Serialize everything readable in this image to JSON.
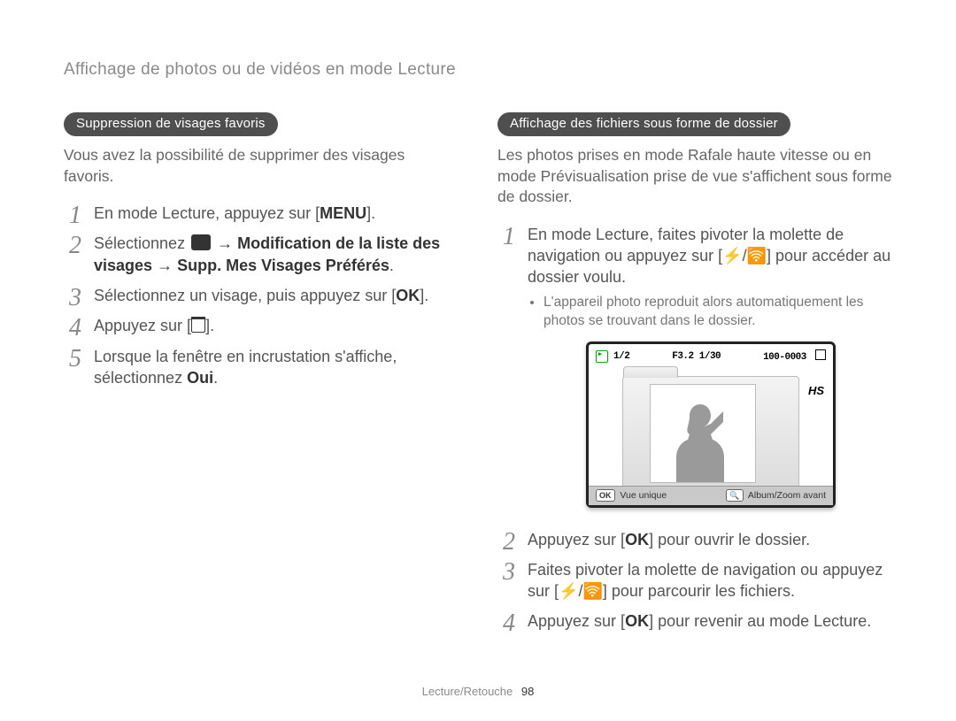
{
  "header": {
    "breadcrumb": "Affichage de photos ou de vidéos en mode Lecture"
  },
  "left": {
    "pill": "Suppression de visages favoris",
    "intro": "Vous avez la possibilité de supprimer des visages favoris.",
    "steps": {
      "s1_pre": "En mode Lecture, appuyez sur [",
      "s1_key": "MENU",
      "s1_post": "].",
      "s2_pre": "Sélectionnez ",
      "s2_arrow1": " → ",
      "s2_bold1": "Modification de la liste des visages",
      "s2_arrow2": " → ",
      "s2_bold2": "Supp. Mes Visages Préférés",
      "s2_post": ".",
      "s3_pre": "Sélectionnez un visage, puis appuyez sur [",
      "s3_key": "OK",
      "s3_post": "].",
      "s4_pre": "Appuyez sur [",
      "s4_post": "].",
      "s5_a": "Lorsque la fenêtre en incrustation s'affiche, sélectionnez ",
      "s5_bold": "Oui",
      "s5_post": "."
    }
  },
  "right": {
    "pill": "Affichage des fichiers sous forme de dossier",
    "intro": "Les photos prises en mode Rafale haute vitesse ou en mode Prévisualisation prise de vue s'affichent sous forme de dossier.",
    "steps": {
      "s1_a": "En mode Lecture, faites pivoter la molette de navigation ou appuyez sur [",
      "s1_b": "/",
      "s1_c": "] pour accéder au dossier voulu.",
      "bullet1": "L'appareil photo reproduit alors automatiquement les photos se trouvant dans le dossier.",
      "s2_pre": "Appuyez sur [",
      "s2_key": "OK",
      "s2_post": "] pour ouvrir le dossier.",
      "s3_a": "Faites pivoter la molette de navigation ou appuyez sur [",
      "s3_b": "/",
      "s3_c": "] pour parcourir les fichiers.",
      "s4_pre": "Appuyez sur [",
      "s4_key": "OK",
      "s4_post": "] pour revenir au mode Lecture."
    },
    "preview": {
      "counter": "1/2",
      "exposure": "F3.2 1/30",
      "fileno": "100-0003",
      "badge_hs": "HS",
      "bottom_ok_chip": "OK",
      "bottom_left_label": "Vue unique",
      "bottom_zoom_chip": "🔍",
      "bottom_right_label": "Album/Zoom avant"
    }
  },
  "icons": {
    "menu_key": "MENU",
    "ok_key": "OK",
    "flash": "⚡",
    "wifi": "🛜",
    "trash": "trash"
  },
  "footer": {
    "section": "Lecture/Retouche",
    "page": "98"
  }
}
